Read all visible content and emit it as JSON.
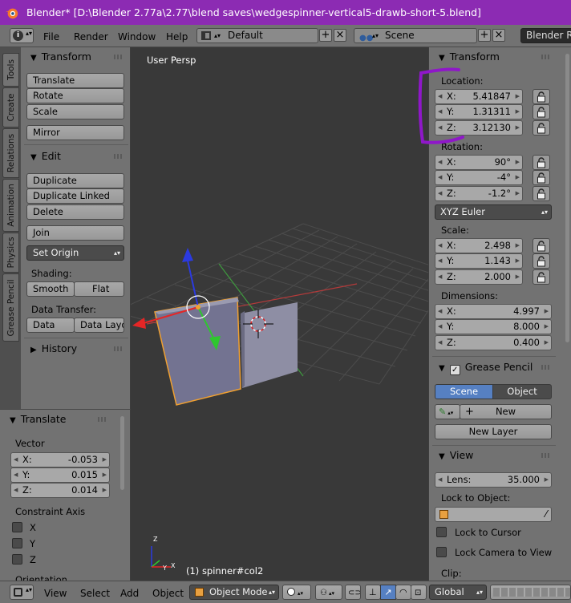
{
  "window": {
    "title": "Blender* [D:\\Blender 2.77a\\2.77\\blend saves\\wedgespinner-vertical5-drawb-short-5.blend]"
  },
  "info_header": {
    "menus": [
      "File",
      "Render",
      "Window",
      "Help"
    ],
    "layout": "Default",
    "scene": "Scene",
    "engine": "Blender Ren"
  },
  "tabs": [
    "Tools",
    "Create",
    "Relations",
    "Animation",
    "Physics",
    "Grease Pencil"
  ],
  "tools": {
    "transform": {
      "title": "Transform",
      "buttons": [
        "Translate",
        "Rotate",
        "Scale",
        "Mirror"
      ]
    },
    "edit": {
      "title": "Edit",
      "buttons": [
        "Duplicate",
        "Duplicate Linked",
        "Delete",
        "Join"
      ],
      "set_origin": "Set Origin",
      "shading_label": "Shading:",
      "smooth": "Smooth",
      "flat": "Flat",
      "data_transfer_label": "Data Transfer:",
      "data": "Data",
      "data_layo": "Data Layo"
    },
    "history": {
      "title": "History"
    }
  },
  "redo": {
    "title": "Translate",
    "vector_label": "Vector",
    "vector": [
      {
        "axis": "X:",
        "value": "-0.053"
      },
      {
        "axis": "Y:",
        "value": "0.015"
      },
      {
        "axis": "Z:",
        "value": "0.014"
      }
    ],
    "constraint_label": "Constraint Axis",
    "constraints": [
      "X",
      "Y",
      "Z"
    ],
    "orientation_label": "Orientation"
  },
  "viewport": {
    "label": "User Persp",
    "object_info": "(1) spinner#col2",
    "axis_labels": [
      "Z",
      "Y",
      "X"
    ]
  },
  "properties": {
    "transform_title": "Transform",
    "location_label": "Location:",
    "location": [
      {
        "axis": "X:",
        "value": "5.41847"
      },
      {
        "axis": "Y:",
        "value": "1.31311"
      },
      {
        "axis": "Z:",
        "value": "3.12130"
      }
    ],
    "rotation_label": "Rotation:",
    "rotation": [
      {
        "axis": "X:",
        "value": "90°"
      },
      {
        "axis": "Y:",
        "value": "-4°"
      },
      {
        "axis": "Z:",
        "value": "-1.2°"
      }
    ],
    "rotation_mode": "XYZ Euler",
    "scale_label": "Scale:",
    "scale": [
      {
        "axis": "X:",
        "value": "2.498"
      },
      {
        "axis": "Y:",
        "value": "1.143"
      },
      {
        "axis": "Z:",
        "value": "2.000"
      }
    ],
    "dimensions_label": "Dimensions:",
    "dimensions": [
      {
        "axis": "X:",
        "value": "4.997"
      },
      {
        "axis": "Y:",
        "value": "8.000"
      },
      {
        "axis": "Z:",
        "value": "0.400"
      }
    ],
    "grease_pencil_title": "Grease Pencil",
    "gp_scene": "Scene",
    "gp_object": "Object",
    "gp_new": "New",
    "gp_new_layer": "New Layer",
    "view_title": "View",
    "lens_label": "Lens:",
    "lens_value": "35.000",
    "lock_to_object_label": "Lock to Object:",
    "lock_to_cursor": "Lock to Cursor",
    "lock_camera_to_view": "Lock Camera to View",
    "clip_label": "Clip:"
  },
  "bottom_header": {
    "menus": [
      "View",
      "Select",
      "Add",
      "Object"
    ],
    "mode": "Object Mode",
    "orientation": "Global"
  },
  "colors": {
    "title_bar": "#8c2bb3",
    "annotation": "#8f17c9",
    "active_toggle": "#5680c2",
    "selected_outline": "#f0a030"
  }
}
